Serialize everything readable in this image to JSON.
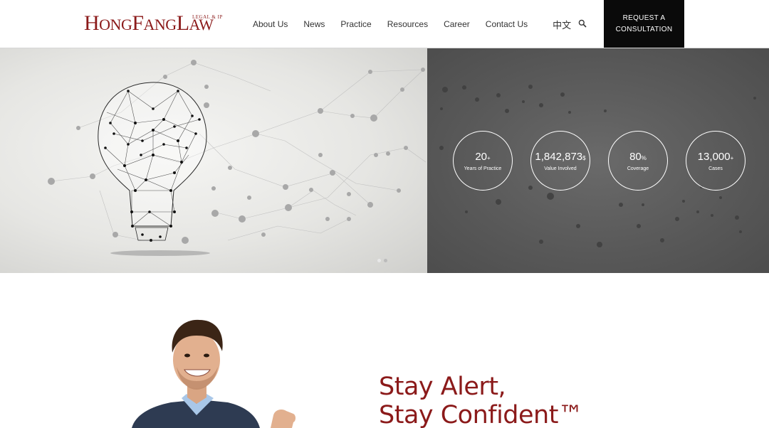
{
  "header": {
    "logo_main": "HongFangLaw",
    "logo_sub": "LEGAL & IP",
    "nav": [
      "About Us",
      "News",
      "Practice",
      "Resources",
      "Career",
      "Contact Us"
    ],
    "language_label": "中文",
    "cta_line1": "REQUEST A",
    "cta_line2": "CONSULTATION"
  },
  "stats": [
    {
      "value": "20",
      "unit": "+",
      "label": "Years of Practice"
    },
    {
      "value": "1,842,873",
      "unit": "$",
      "label": "Value Involved"
    },
    {
      "value": "80",
      "unit": "%",
      "label": "Coverage"
    },
    {
      "value": "13,000",
      "unit": "+",
      "label": "Cases"
    }
  ],
  "carousel": {
    "slides": 2,
    "active_index": 0
  },
  "promo": {
    "line1": "Stay Alert,",
    "line2": "Stay Confident™"
  },
  "colors": {
    "brand": "#8b1a1a",
    "cta_bg": "#0a0a0a"
  },
  "icons": {
    "search": "search-icon"
  }
}
